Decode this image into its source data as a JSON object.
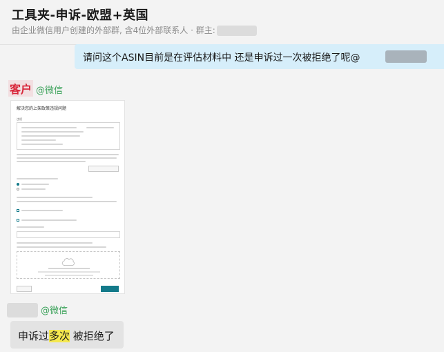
{
  "header": {
    "title": "工具夹-申诉-欧盟+英国",
    "subtitle": "由企业微信用户创建的外部群, 含4位外部联系人 · 群主:"
  },
  "messages": {
    "outgoing_1": {
      "text": "请问这个ASIN目前是在评估材料中 还是申诉过一次被拒绝了呢@"
    },
    "sender_1": {
      "name": "客户",
      "via": "@微信"
    },
    "image_message": {
      "form_title": "解决您的上架政策违规问题",
      "field_label": "违规"
    },
    "sender_2": {
      "via": "@微信"
    },
    "incoming_2": {
      "prefix": "申诉过",
      "highlight": "多次",
      "suffix": " 被拒绝了"
    }
  },
  "colors": {
    "background": "#f3f3f3",
    "outgoing_bubble": "#d6eefa",
    "incoming_bubble": "#e3e3e3",
    "customer_name": "#d8263a",
    "wechat_tag": "#3ca25b",
    "highlight": "#f4e84f",
    "form_button": "#137a8a"
  }
}
